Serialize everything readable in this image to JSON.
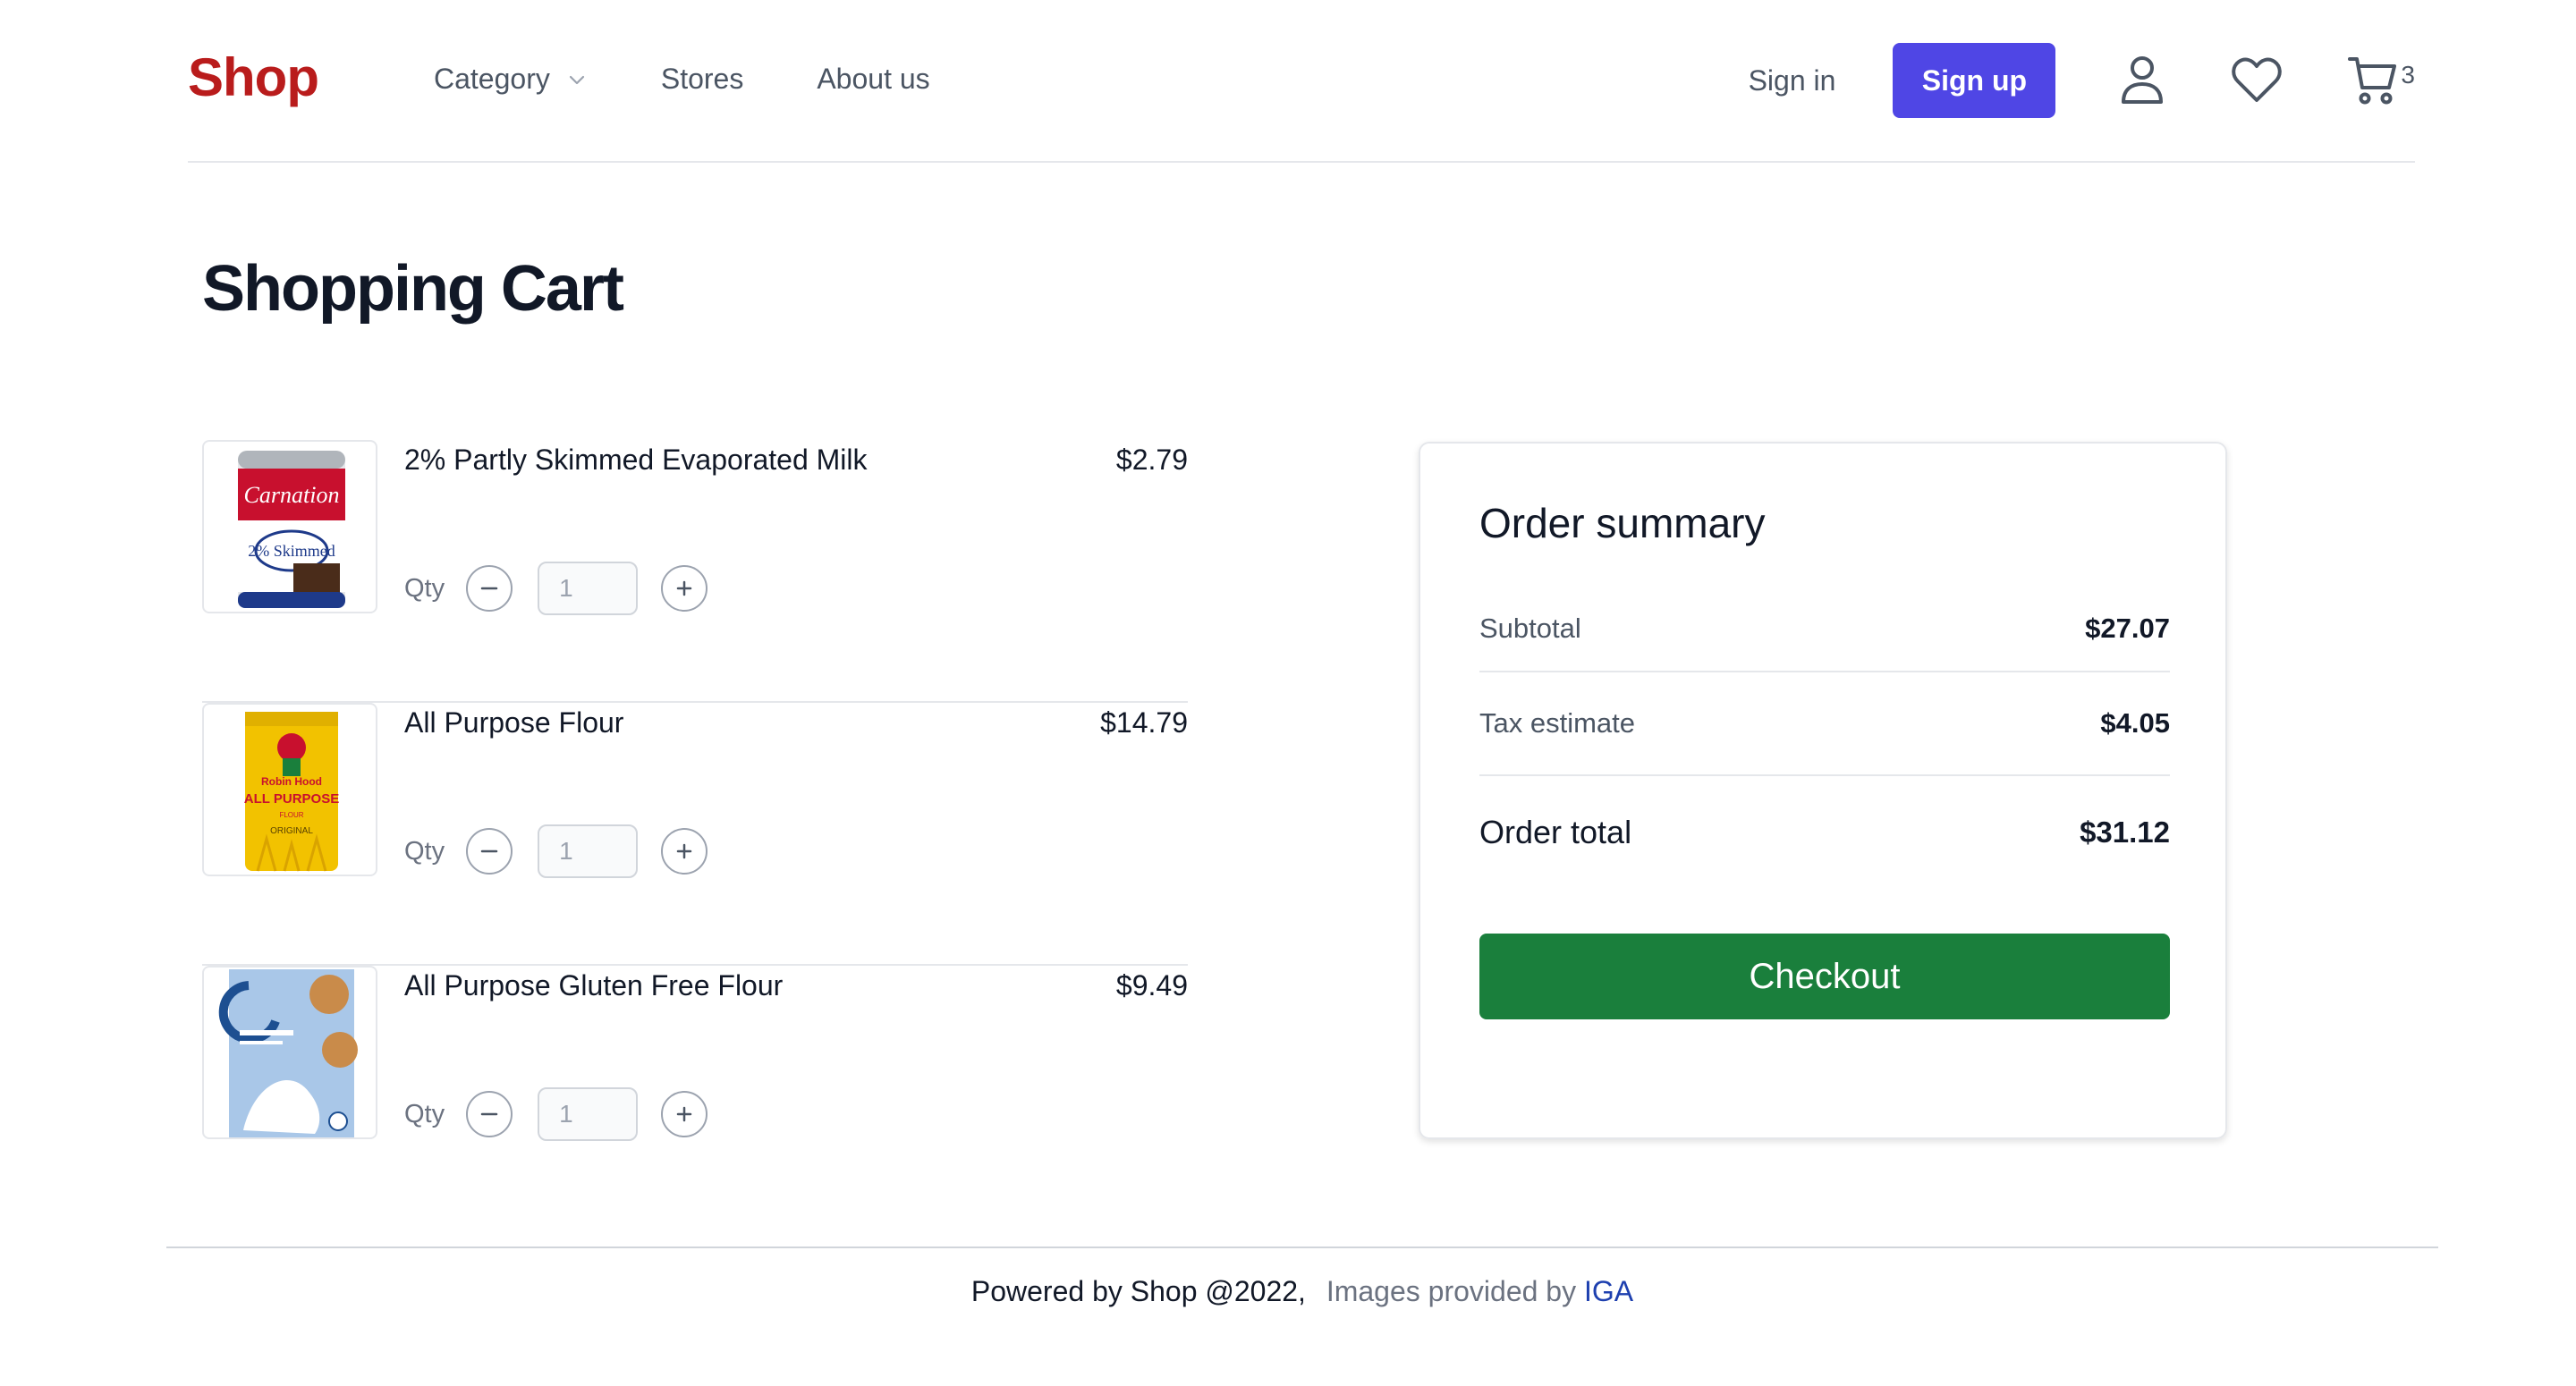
{
  "brand": {
    "name": "Shop",
    "color": "#b91c1c"
  },
  "nav": {
    "category_label": "Category",
    "stores_label": "Stores",
    "about_label": "About us"
  },
  "auth": {
    "signin_label": "Sign in",
    "signup_label": "Sign up"
  },
  "header_icons": {
    "user": "user-icon",
    "wishlist": "heart-icon",
    "cart": "cart-icon",
    "cart_count": "3"
  },
  "page": {
    "title": "Shopping Cart"
  },
  "cart": {
    "qty_label": "Qty",
    "items": [
      {
        "name": "2% Partly Skimmed Evaporated Milk",
        "price": "$2.79",
        "qty": "1",
        "image": "evaporated-milk-can"
      },
      {
        "name": "All Purpose Flour",
        "price": "$14.79",
        "qty": "1",
        "image": "all-purpose-flour-bag"
      },
      {
        "name": "All Purpose Gluten Free Flour",
        "price": "$9.49",
        "qty": "1",
        "image": "gluten-free-flour-box"
      }
    ]
  },
  "summary": {
    "title": "Order summary",
    "subtotal_label": "Subtotal",
    "subtotal_value": "$27.07",
    "tax_label": "Tax estimate",
    "tax_value": "$4.05",
    "total_label": "Order total",
    "total_value": "$31.12",
    "checkout_label": "Checkout"
  },
  "footer": {
    "powered": "Powered by Shop @2022,",
    "images_prefix": "Images provided by",
    "images_link": "IGA"
  },
  "colors": {
    "accent": "#4f46e5",
    "checkout": "#1a7f3c",
    "link": "#1e40af"
  }
}
